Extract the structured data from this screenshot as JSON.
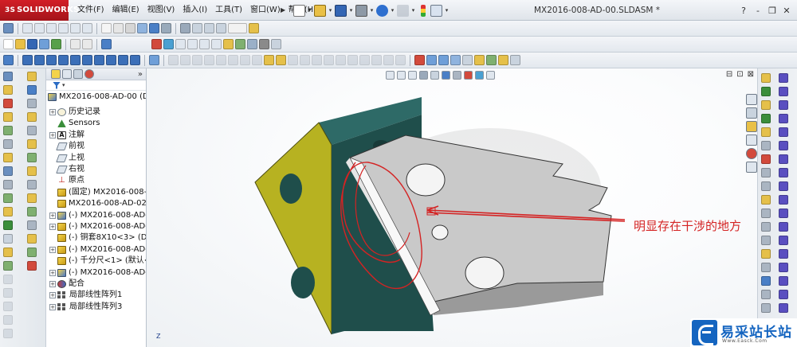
{
  "app": {
    "logo_ds": "3S",
    "logo": "SOLIDWORKS",
    "document_title": "MX2016-008-AD-00.SLDASM *"
  },
  "menu": [
    "文件(F)",
    "编辑(E)",
    "视图(V)",
    "插入(I)",
    "工具(T)",
    "窗口(W)",
    "帮助(H)"
  ],
  "window_controls": [
    "?",
    "-",
    "❐",
    "✕"
  ],
  "feature_tree": {
    "collapse_symbol": "»",
    "root": "MX2016-008-AD-00  (D",
    "nodes": [
      {
        "label": "历史记录",
        "icon": "history-icon",
        "expandable": true
      },
      {
        "label": "Sensors",
        "icon": "sensor-icon",
        "expandable": false
      },
      {
        "label": "注解",
        "icon": "annotation-icon",
        "expandable": true
      },
      {
        "label": "前视",
        "icon": "plane-icon",
        "expandable": false
      },
      {
        "label": "上视",
        "icon": "plane-icon",
        "expandable": false
      },
      {
        "label": "右视",
        "icon": "plane-icon",
        "expandable": false
      },
      {
        "label": "原点",
        "icon": "origin-icon",
        "expandable": false
      },
      {
        "label": "(固定) MX2016-008-A",
        "icon": "part-icon",
        "expandable": false
      },
      {
        "label": "MX2016-008-AD-02",
        "icon": "part-icon",
        "expandable": false
      },
      {
        "label": "(-) MX2016-008-AD-",
        "icon": "assembly-icon",
        "expandable": true
      },
      {
        "label": "(-) MX2016-008-AD-",
        "icon": "part-icon",
        "expandable": true
      },
      {
        "label": "(-) 铜套8X10<3> (De",
        "icon": "part-icon",
        "expandable": false
      },
      {
        "label": "(-) MX2016-008-AD-",
        "icon": "part-icon",
        "expandable": true
      },
      {
        "label": "(-) 千分尺<1> (默认<",
        "icon": "part-icon",
        "expandable": false
      },
      {
        "label": "(-) MX2016-008-AD-",
        "icon": "assembly-icon",
        "expandable": true
      },
      {
        "label": "配合",
        "icon": "mate-icon",
        "expandable": true
      },
      {
        "label": "局部线性阵列1",
        "icon": "pattern-icon",
        "expandable": true
      },
      {
        "label": "局部线性阵列3",
        "icon": "pattern-icon",
        "expandable": true
      }
    ]
  },
  "graphics": {
    "annotation": "明显存在干涉的地方",
    "annotation_color": "#d42323",
    "view_controls": [
      "⊟",
      "⊡",
      "⊠"
    ],
    "triad_label": "Z"
  },
  "watermark": {
    "text": "易采站长站",
    "subtext": "Www.Easck.Com"
  },
  "colors": {
    "brand_red": "#c41a20",
    "part_yellow": "#b7b221",
    "part_teal": "#2e6a67",
    "part_gray": "#c9c9c9",
    "accent_blue": "#1565c0"
  }
}
